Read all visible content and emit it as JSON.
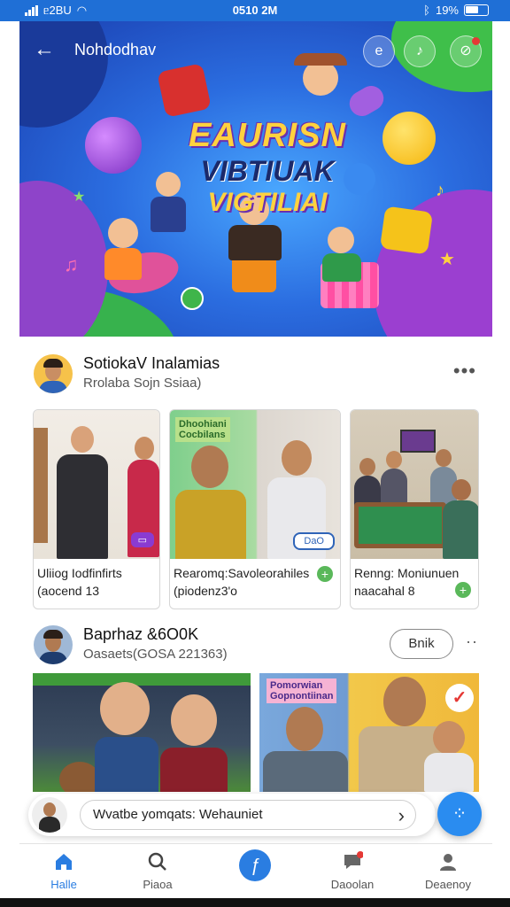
{
  "status_bar": {
    "left": "ᥱ2BU",
    "time": "0510 2M",
    "battery": "19%"
  },
  "header": {
    "title": "Nohdodhav"
  },
  "hero": {
    "line1": "EAURISN",
    "line2": "VIBTIUAK",
    "line3": "VIGTILIAI"
  },
  "post1": {
    "name": "SotiokaV Inalamias",
    "subtitle": "Rrolaba Sojn Ssiaa)",
    "items": [
      {
        "caption1": "Uliiog Iodfinfirts",
        "caption2": "(aocend 13",
        "badge": ""
      },
      {
        "sign_line1": "Dhoohiani",
        "sign_line2": "Cocbilans",
        "caption1": "Rearomq:Savoleorahiles",
        "caption2": "(piodenz3'o",
        "badge": "DaO"
      },
      {
        "caption1": "Renng: Moniunuen",
        "caption2": "naacahal 8",
        "badge": ""
      }
    ]
  },
  "post2": {
    "name": "Baprhaz &6O0K",
    "subtitle": "Oasaets(GOSA 221363)",
    "follow_label": "Bnik",
    "more": "··",
    "banner_line1": "Pomorwian",
    "banner_line2": "Gopnontiinan"
  },
  "composer": {
    "text": "Wvatbe yomqats: Wehauniet"
  },
  "nav": [
    {
      "label": "Halle",
      "icon": "home-icon"
    },
    {
      "label": "Piaoa",
      "icon": "search-icon"
    },
    {
      "label": "",
      "icon": "create-icon"
    },
    {
      "label": "Daoolan",
      "icon": "chat-icon"
    },
    {
      "label": "Deaenoy",
      "icon": "profile-icon"
    }
  ],
  "colors": {
    "accent": "#2a7de1",
    "status_bar": "#1f6fd6",
    "fab": "#2a8cf0"
  }
}
